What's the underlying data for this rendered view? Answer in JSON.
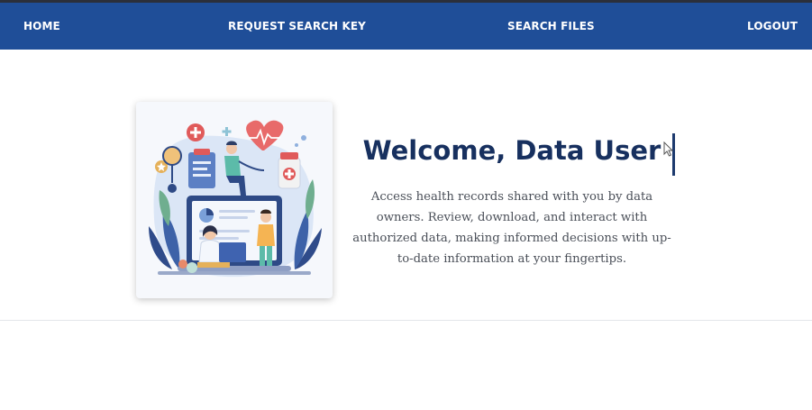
{
  "nav": {
    "home": "HOME",
    "request_search_key": "REQUEST SEARCH KEY",
    "search_files": "SEARCH FILES",
    "logout": "LOGOUT"
  },
  "hero": {
    "title": "Welcome, Data User",
    "description": "Access health records shared with you by data owners. Review, download, and interact with authorized data, making informed decisions with up-to-date information at your fingertips."
  },
  "illustration": "healthcare-data-illustration",
  "colors": {
    "navbar": "#1f4e98",
    "title": "#17305f",
    "body_text": "#4a4f58"
  }
}
